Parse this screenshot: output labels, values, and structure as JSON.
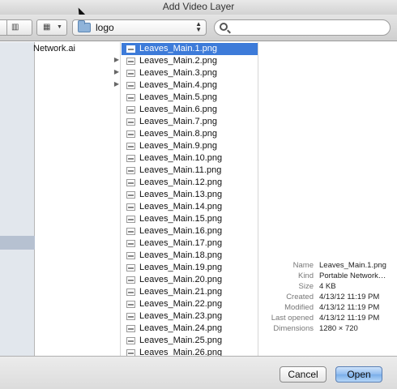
{
  "window": {
    "title": "Add Video Layer"
  },
  "toolbar": {
    "path_folder": "logo",
    "search": {
      "value": "",
      "placeholder": ""
    }
  },
  "browser": {
    "column1": [
      {
        "label": "Network.ai",
        "has_children": false
      },
      {
        "label": "",
        "has_children": true
      },
      {
        "label": "",
        "has_children": true
      },
      {
        "label": "",
        "has_children": true
      }
    ],
    "files": [
      "Leaves_Main.1.png",
      "Leaves_Main.2.png",
      "Leaves_Main.3.png",
      "Leaves_Main.4.png",
      "Leaves_Main.5.png",
      "Leaves_Main.6.png",
      "Leaves_Main.7.png",
      "Leaves_Main.8.png",
      "Leaves_Main.9.png",
      "Leaves_Main.10.png",
      "Leaves_Main.11.png",
      "Leaves_Main.12.png",
      "Leaves_Main.13.png",
      "Leaves_Main.14.png",
      "Leaves_Main.15.png",
      "Leaves_Main.16.png",
      "Leaves_Main.17.png",
      "Leaves_Main.18.png",
      "Leaves_Main.19.png",
      "Leaves_Main.20.png",
      "Leaves_Main.21.png",
      "Leaves_Main.22.png",
      "Leaves_Main.23.png",
      "Leaves_Main.24.png",
      "Leaves_Main.25.png",
      "Leaves_Main.26.png"
    ],
    "selected_index": 0
  },
  "preview": {
    "info": [
      {
        "key": "Name",
        "value": "Leaves_Main.1.png"
      },
      {
        "key": "Kind",
        "value": "Portable Network…"
      },
      {
        "key": "Size",
        "value": "4 KB"
      },
      {
        "key": "Created",
        "value": "4/13/12 11:19 PM"
      },
      {
        "key": "Modified",
        "value": "4/13/12 11:19 PM"
      },
      {
        "key": "Last opened",
        "value": "4/13/12 11:19 PM"
      },
      {
        "key": "Dimensions",
        "value": "1280 × 720"
      }
    ]
  },
  "footer": {
    "cancel_label": "Cancel",
    "open_label": "Open"
  },
  "colors": {
    "selection": "#3d7bd9",
    "sidebar": "#e2e7ed"
  }
}
